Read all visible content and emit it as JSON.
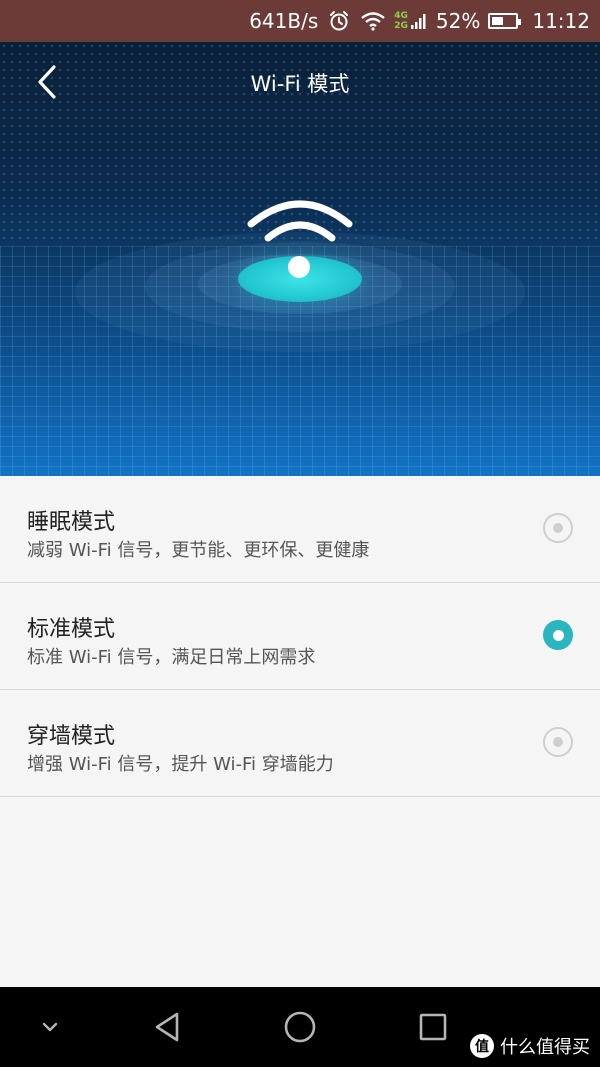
{
  "status_bar": {
    "net_speed": "641B/s",
    "net_badge_top": "4G",
    "net_badge_bottom": "2G",
    "battery": "52%",
    "battery_level": 0.52,
    "time": "11:12"
  },
  "header": {
    "title": "Wi-Fi 模式"
  },
  "options": [
    {
      "title": "睡眠模式",
      "desc": "减弱 Wi-Fi 信号，更节能、更环保、更健康",
      "selected": false
    },
    {
      "title": "标准模式",
      "desc": "标准 Wi-Fi 信号，满足日常上网需求",
      "selected": true
    },
    {
      "title": "穿墙模式",
      "desc": "增强 Wi-Fi 信号，提升 Wi-Fi 穿墙能力",
      "selected": false
    }
  ],
  "watermark": {
    "logo_char": "值",
    "text": "什么值得买"
  },
  "colors": {
    "accent": "#2ab5c0",
    "status_bar": "#6d3b37",
    "radio_unchecked": "#cfcfcf"
  },
  "icons": {
    "back": "back-arrow-icon",
    "hero": "wifi-signal-icon",
    "nav_hide": "chevron-down-icon",
    "nav_back": "back-triangle-icon",
    "nav_home": "home-circle-icon",
    "nav_recent": "recent-square-icon"
  }
}
